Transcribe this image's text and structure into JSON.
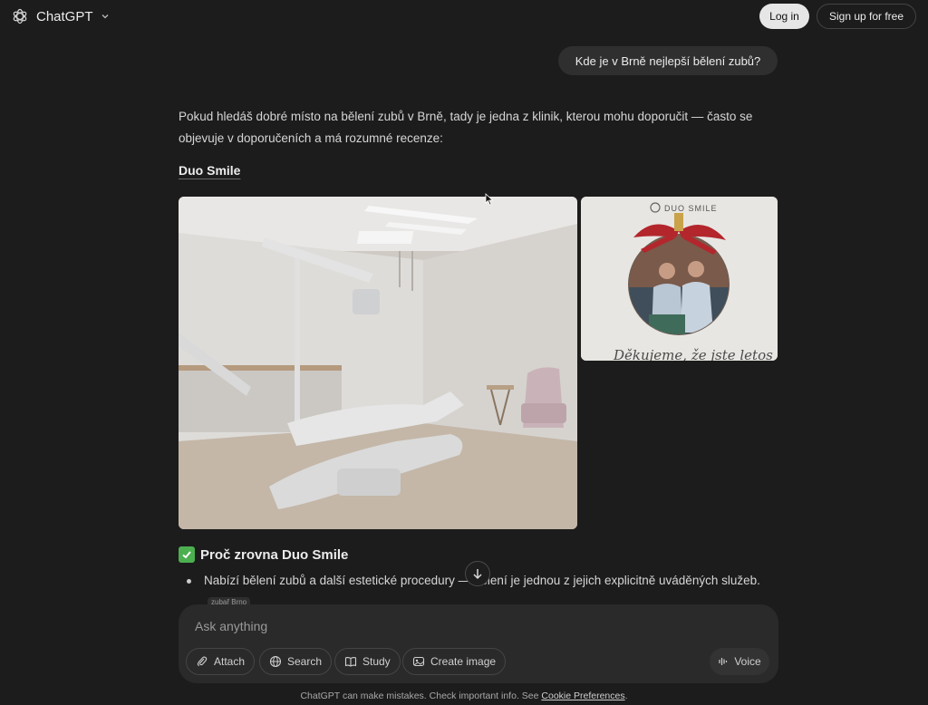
{
  "header": {
    "app_name": "ChatGPT",
    "login_label": "Log in",
    "signup_label": "Sign up for free"
  },
  "conversation": {
    "user_message": "Kde je v Brně nejlepší bělení zubů?",
    "assistant_intro_line1": "Pokud hledáš dobré místo na bělení zubů v Brně, tady je jedna z klinik, kterou mohu doporučit — často se",
    "assistant_intro_line2": "objevuje v doporučeních a má rozumné recenze:",
    "clinic_name": "Duo Smile",
    "side_image_logo_text": "DUO SMILE",
    "side_image_caption": "Děkujeme, že jste letos",
    "section_title": "Proč zrovna Duo Smile",
    "bullet_1": "Nabízí bělení zubů a další estetické procedury — bělení je jednou z jejich explicitně uváděných služeb.",
    "source_chip": "zubař Brno"
  },
  "composer": {
    "placeholder": "Ask anything",
    "tools": [
      "Attach",
      "Search",
      "Study",
      "Create image"
    ],
    "voice_label": "Voice"
  },
  "footer": {
    "disclaimer": "ChatGPT can make mistakes. Check important info. See",
    "cookie_link": "Cookie Preferences",
    "end": "."
  },
  "colors": {
    "background": "#1c1c1c",
    "bubble": "#2f2f2f",
    "composer": "#2a2a2a",
    "check_green": "#4caf50",
    "ribbon_red": "#b3262c"
  },
  "icons": {
    "logo": "openai-logo-icon",
    "chevron": "chevron-down-icon",
    "scroll": "arrow-down-icon",
    "attach": "paperclip-icon",
    "search": "globe-icon",
    "study": "book-icon",
    "create_image": "image-icon",
    "voice": "waveform-icon"
  }
}
